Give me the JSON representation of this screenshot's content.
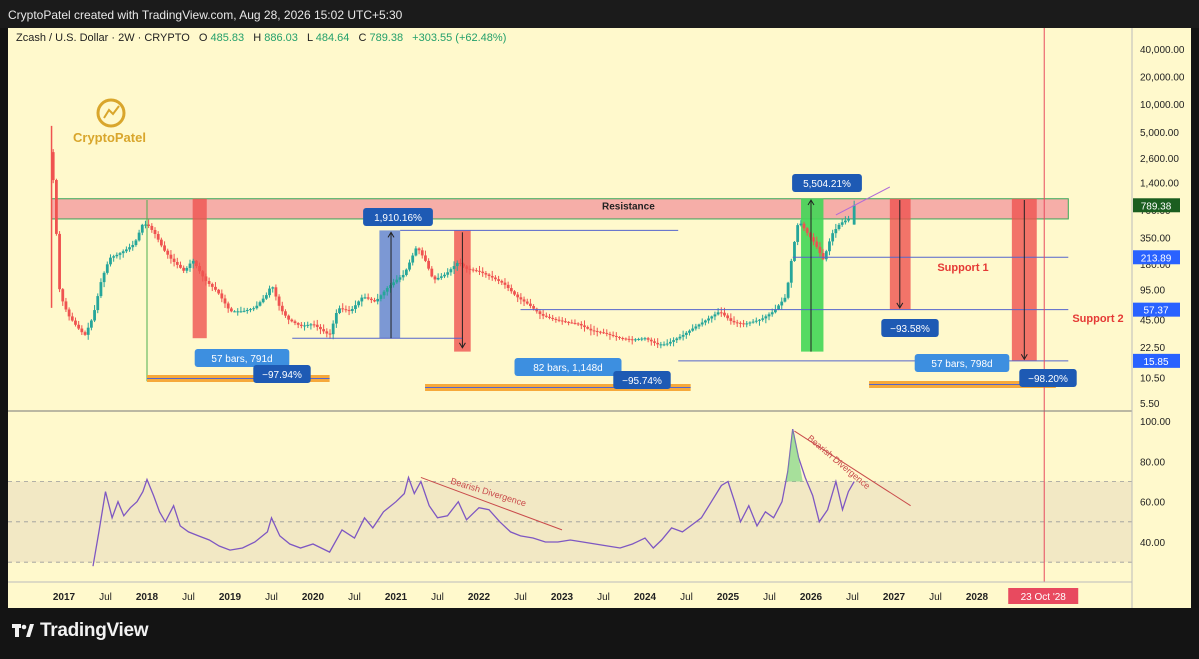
{
  "header": {
    "credit": "CryptoPatel created with TradingView.com, Aug 28, 2026 15:02 UTC+5:30"
  },
  "symbol_line": {
    "name": "Zcash / U.S. Dollar · 2W · CRYPTO",
    "o_label": "O",
    "o": "485.83",
    "h_label": "H",
    "h": "886.03",
    "l_label": "L",
    "l": "484.64",
    "c_label": "C",
    "c": "789.38",
    "change": "+303.55 (+62.48%)"
  },
  "watermark": {
    "text": "CryptoPatel"
  },
  "brand": {
    "name": "TradingView"
  },
  "colors": {
    "background": "#fff9cc",
    "up": "#26a69a",
    "down": "#ef5350",
    "rsi_line": "#7e57c2",
    "resistance_zone": "#f4a1a1",
    "label_blue": "#1e5ab4",
    "label_cyan": "#3d8fe0",
    "support_text": "#e53935"
  },
  "icons": [
    "tradingview-logo-icon",
    "cryptopatel-logo-icon"
  ],
  "chart_data": [
    {
      "type": "candlestick",
      "title": "Zcash / U.S. Dollar · 2W · CRYPTO",
      "y_scale": "log",
      "ylim": [
        5.5,
        45000
      ],
      "y_ticks": [
        "40,000.00",
        "20,000.00",
        "10,000.00",
        "5,000.00",
        "2,600.00",
        "1,400.00",
        "700.00",
        "350.00",
        "180.00",
        "95.00",
        "45.00",
        "22.50",
        "10.50",
        "5.50"
      ],
      "x_ticks": [
        "2017",
        "Jul",
        "2018",
        "Jul",
        "2019",
        "Jul",
        "2020",
        "Jul",
        "2021",
        "Jul",
        "2022",
        "Jul",
        "2023",
        "Jul",
        "2024",
        "Jul",
        "2025",
        "Jul",
        "2026",
        "Jul",
        "2027",
        "Jul",
        "2028",
        "Jul"
      ],
      "x_tick_years": [
        2017.0,
        2017.5,
        2018.0,
        2018.5,
        2019.0,
        2019.5,
        2020.0,
        2020.5,
        2021.0,
        2021.5,
        2022.0,
        2022.5,
        2023.0,
        2023.5,
        2024.0,
        2024.5,
        2025.0,
        2025.5,
        2026.0,
        2026.5,
        2027.0,
        2027.5,
        2028.0,
        2028.5
      ],
      "close_path": [
        [
          2016.85,
          3000
        ],
        [
          2016.9,
          520
        ],
        [
          2016.95,
          85
        ],
        [
          2017.05,
          50
        ],
        [
          2017.15,
          38
        ],
        [
          2017.25,
          30
        ],
        [
          2017.35,
          48
        ],
        [
          2017.45,
          120
        ],
        [
          2017.55,
          210
        ],
        [
          2017.65,
          230
        ],
        [
          2017.75,
          260
        ],
        [
          2017.85,
          300
        ],
        [
          2017.95,
          500
        ],
        [
          2018.02,
          470
        ],
        [
          2018.1,
          380
        ],
        [
          2018.2,
          260
        ],
        [
          2018.3,
          200
        ],
        [
          2018.45,
          150
        ],
        [
          2018.55,
          200
        ],
        [
          2018.7,
          120
        ],
        [
          2018.85,
          90
        ],
        [
          2019.0,
          55
        ],
        [
          2019.15,
          55
        ],
        [
          2019.3,
          60
        ],
        [
          2019.45,
          85
        ],
        [
          2019.5,
          110
        ],
        [
          2019.6,
          60
        ],
        [
          2019.7,
          45
        ],
        [
          2019.85,
          38
        ],
        [
          2020.0,
          40
        ],
        [
          2020.2,
          30
        ],
        [
          2020.3,
          60
        ],
        [
          2020.45,
          55
        ],
        [
          2020.6,
          80
        ],
        [
          2020.75,
          70
        ],
        [
          2020.9,
          100
        ],
        [
          2021.0,
          120
        ],
        [
          2021.1,
          140
        ],
        [
          2021.25,
          280
        ],
        [
          2021.35,
          200
        ],
        [
          2021.45,
          120
        ],
        [
          2021.6,
          140
        ],
        [
          2021.75,
          190
        ],
        [
          2021.85,
          160
        ],
        [
          2022.0,
          150
        ],
        [
          2022.15,
          130
        ],
        [
          2022.3,
          110
        ],
        [
          2022.45,
          80
        ],
        [
          2022.6,
          65
        ],
        [
          2022.75,
          50
        ],
        [
          2022.9,
          45
        ],
        [
          2023.05,
          42
        ],
        [
          2023.2,
          40
        ],
        [
          2023.35,
          34
        ],
        [
          2023.5,
          32
        ],
        [
          2023.7,
          28
        ],
        [
          2023.85,
          27
        ],
        [
          2024.0,
          28
        ],
        [
          2024.15,
          24
        ],
        [
          2024.25,
          24
        ],
        [
          2024.45,
          30
        ],
        [
          2024.6,
          37
        ],
        [
          2024.75,
          45
        ],
        [
          2024.9,
          55
        ],
        [
          2025.05,
          42
        ],
        [
          2025.2,
          40
        ],
        [
          2025.4,
          45
        ],
        [
          2025.55,
          55
        ],
        [
          2025.7,
          80
        ],
        [
          2025.78,
          250
        ],
        [
          2025.85,
          540
        ],
        [
          2025.95,
          400
        ],
        [
          2026.05,
          300
        ],
        [
          2026.15,
          200
        ],
        [
          2026.25,
          380
        ],
        [
          2026.35,
          500
        ],
        [
          2026.45,
          560
        ],
        [
          2026.52,
          789.38
        ]
      ],
      "last_candle": {
        "open": 485.83,
        "high": 886.03,
        "low": 484.64,
        "close": 789.38,
        "change": 303.55,
        "change_pct": 62.48
      },
      "price_tags": [
        {
          "value": 789.38,
          "text": "789.38"
        },
        {
          "value": 213.89,
          "text": "213.89"
        },
        {
          "value": 57.37,
          "text": "57.37"
        },
        {
          "value": 15.85,
          "text": "15.85"
        }
      ],
      "levels": {
        "resistance": {
          "label": "Resistance",
          "from": 560,
          "to": 930
        },
        "support_1": {
          "label": "Support 1",
          "value": 213.89
        },
        "support_2": {
          "label": "Support 2",
          "value": 57.37
        },
        "bottom": {
          "value": 15.85
        }
      },
      "annotations": {
        "range_1_bars": "57 bars, 791d",
        "range_1_drop": "−97.94%",
        "range_2_gain": "1,910.16%",
        "range_3_bars": "82 bars, 1,148d",
        "range_3_drop": "−95.74%",
        "range_4_gain": "5,504.21%",
        "range_5_drop": "−93.58%",
        "range_6_bars": "57 bars, 798d",
        "range_6_drop": "−98.20%",
        "date_marker": "23 Oct '28"
      }
    },
    {
      "type": "line",
      "title": "RSI",
      "ylim": [
        25,
        100
      ],
      "y_ticks": [
        "100.00",
        "80.00",
        "60.00",
        "40.00"
      ],
      "band": [
        30,
        70
      ],
      "midline": 50,
      "series": [
        {
          "values": [
            [
              2017.35,
              28
            ],
            [
              2017.42,
              45
            ],
            [
              2017.5,
              65
            ],
            [
              2017.58,
              52
            ],
            [
              2017.65,
              60
            ],
            [
              2017.72,
              53
            ],
            [
              2017.8,
              57
            ],
            [
              2017.88,
              60
            ],
            [
              2017.95,
              65
            ],
            [
              2018.0,
              71
            ],
            [
              2018.08,
              63
            ],
            [
              2018.15,
              55
            ],
            [
              2018.22,
              50
            ],
            [
              2018.32,
              58
            ],
            [
              2018.4,
              48
            ],
            [
              2018.5,
              45
            ],
            [
              2018.62,
              43
            ],
            [
              2018.75,
              41
            ],
            [
              2018.87,
              38
            ],
            [
              2019.0,
              36
            ],
            [
              2019.15,
              37
            ],
            [
              2019.3,
              40
            ],
            [
              2019.45,
              45
            ],
            [
              2019.5,
              52
            ],
            [
              2019.6,
              43
            ],
            [
              2019.72,
              39
            ],
            [
              2019.85,
              37
            ],
            [
              2020.0,
              39
            ],
            [
              2020.2,
              35
            ],
            [
              2020.35,
              46
            ],
            [
              2020.5,
              42
            ],
            [
              2020.62,
              52
            ],
            [
              2020.72,
              47
            ],
            [
              2020.85,
              55
            ],
            [
              2021.0,
              60
            ],
            [
              2021.1,
              64
            ],
            [
              2021.15,
              72
            ],
            [
              2021.22,
              64
            ],
            [
              2021.3,
              70
            ],
            [
              2021.4,
              58
            ],
            [
              2021.5,
              52
            ],
            [
              2021.62,
              53
            ],
            [
              2021.75,
              60
            ],
            [
              2021.85,
              51
            ],
            [
              2022.0,
              57
            ],
            [
              2022.12,
              56
            ],
            [
              2022.25,
              50
            ],
            [
              2022.38,
              45
            ],
            [
              2022.5,
              43
            ],
            [
              2022.65,
              42
            ],
            [
              2022.8,
              40
            ],
            [
              2022.95,
              40
            ],
            [
              2023.1,
              41
            ],
            [
              2023.25,
              40
            ],
            [
              2023.4,
              39
            ],
            [
              2023.55,
              38
            ],
            [
              2023.7,
              37
            ],
            [
              2023.85,
              39
            ],
            [
              2024.0,
              42
            ],
            [
              2024.1,
              37
            ],
            [
              2024.2,
              41
            ],
            [
              2024.32,
              47
            ],
            [
              2024.45,
              45
            ],
            [
              2024.55,
              48
            ],
            [
              2024.68,
              52
            ],
            [
              2024.8,
              60
            ],
            [
              2024.92,
              68
            ],
            [
              2025.0,
              70
            ],
            [
              2025.08,
              60
            ],
            [
              2025.15,
              50
            ],
            [
              2025.25,
              58
            ],
            [
              2025.35,
              48
            ],
            [
              2025.45,
              55
            ],
            [
              2025.55,
              52
            ],
            [
              2025.65,
              60
            ],
            [
              2025.72,
              75
            ],
            [
              2025.78,
              96
            ],
            [
              2025.85,
              82
            ],
            [
              2025.93,
              72
            ],
            [
              2026.02,
              63
            ],
            [
              2026.1,
              50
            ],
            [
              2026.2,
              56
            ],
            [
              2026.3,
              70
            ],
            [
              2026.38,
              56
            ],
            [
              2026.45,
              65
            ],
            [
              2026.52,
              70
            ]
          ]
        }
      ],
      "annotations": {
        "divergence_1": "Bearish Divergence",
        "divergence_2": "Bearish Divergence"
      }
    }
  ]
}
